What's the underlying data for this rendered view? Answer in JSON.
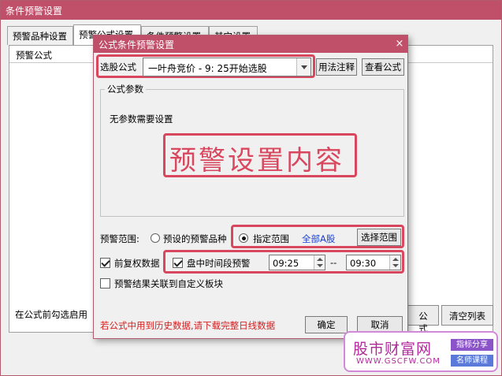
{
  "outer": {
    "title": "条件预警设置",
    "tabs": [
      "预警品种设置",
      "预警公式设置",
      "条件预警设置",
      "其它设置"
    ],
    "list_header": "预警公式",
    "foot_label": "在公式前勾选启用",
    "btn_formula": "公式",
    "btn_clear": "清空列表"
  },
  "dialog": {
    "title": "公式条件预警设置",
    "close_glyph": "×",
    "formula_label": "选股公式",
    "formula_value": "一叶舟竞价  - 9: 25开始选股",
    "btn_usage": "用法注释",
    "btn_view": "查看公式",
    "params_title": "公式参数",
    "params_text": "无参数需要设置",
    "overlay_text": "预警设置内容",
    "range_label": "预警范围:",
    "range_option1": "预设的预警品种",
    "range_option2": "指定范围",
    "range_value": "全部A股",
    "btn_select_range": "选择范围",
    "check_adjust": "前复权数据",
    "check_period": "盘中时间段预警",
    "time_start": "09:25",
    "time_sep": "--",
    "time_end": "09:30",
    "check_link": "预警结果关联到自定义板块",
    "warning": "若公式中用到历史数据,请下载完整日线数据",
    "btn_ok": "确定",
    "btn_cancel": "取消"
  },
  "logo": {
    "main": "股市财富网",
    "url": "WWW.GSCFW.COM",
    "tag1": "指标分享",
    "tag2": "名师课程"
  },
  "colors": {
    "title_bar": "#c0506a",
    "highlight": "#d9475f",
    "range_value": "#1a3fd0",
    "warning": "#d42020"
  }
}
